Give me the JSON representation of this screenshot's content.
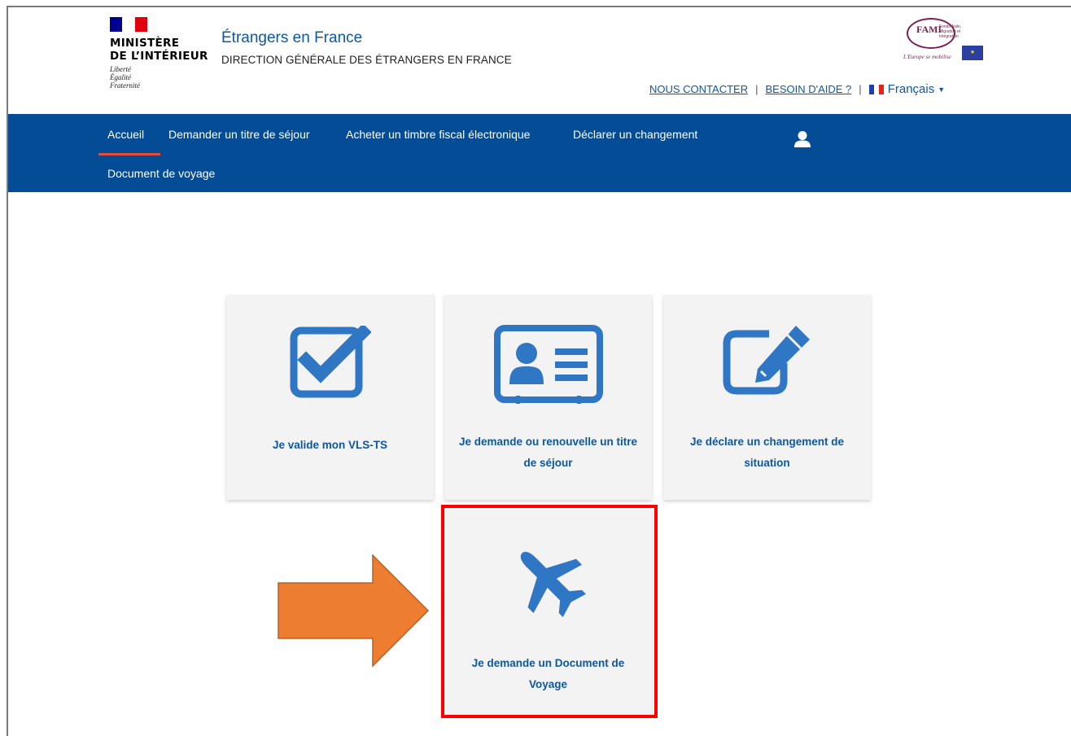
{
  "header": {
    "gov_name": "MINISTÈRE\nDE L’INTÉRIEUR",
    "gov_motto": "Liberté\nÉgalité\nFraternité",
    "site_title": "Étrangers en France",
    "site_subtitle": "DIRECTION GÉNÉRALE DES ÉTRANGERS EN FRANCE",
    "fami_logo_text": "FAMI",
    "fami_logo_subtext": "Fonds Asile, Migration et Intégration",
    "fami_logo_slogan": "L'Europe se mobilise",
    "contact_label": "NOUS CONTACTER",
    "help_label": "BESOIN D'AIDE ?",
    "separator": "|",
    "language_label": "Français"
  },
  "nav": {
    "items": [
      {
        "label": "Accueil"
      },
      {
        "label": "Demander un titre de séjour"
      },
      {
        "label": "Acheter un timbre fiscal électronique"
      },
      {
        "label": "Déclarer un changement"
      },
      {
        "label": "Document de voyage"
      }
    ],
    "active_index": 0,
    "user_icon": "user-icon"
  },
  "tiles": [
    {
      "label": "Je valide mon VLS-TS",
      "icon": "checkbox-icon"
    },
    {
      "label": "Je demande ou renouvelle un titre de séjour",
      "icon": "id-card-icon"
    },
    {
      "label": "Je déclare un changement de situation",
      "icon": "edit-icon"
    },
    {
      "label": "Je demande un Document de Voyage",
      "icon": "airplane-icon"
    }
  ],
  "colors": {
    "brand_blue": "#0d57a3",
    "nav_blue": "#044c95",
    "active_underline": "#e64d38",
    "icon_blue": "#2f76c4",
    "highlight_red": "#ff0000",
    "arrow_orange": "#ed7d31"
  }
}
